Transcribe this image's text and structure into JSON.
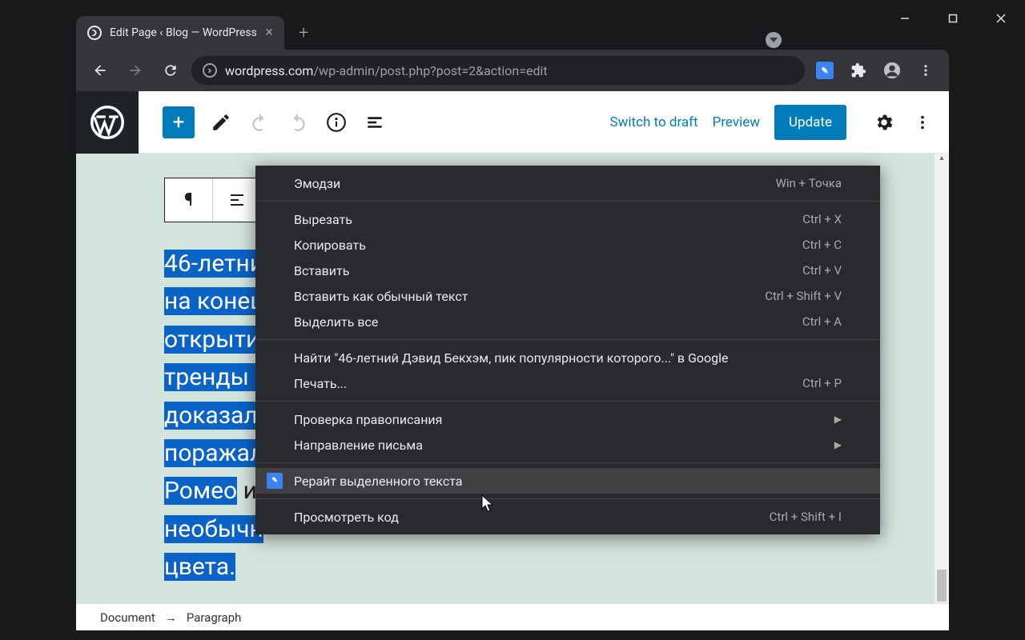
{
  "window": {
    "minimize": "—",
    "maximize": "☐",
    "close": "✕"
  },
  "tab": {
    "title": "Edit Page ‹ Blog — WordPress"
  },
  "url": {
    "host": "wordpress.com",
    "path": "/wp-admin/post.php?post=2&action=edit"
  },
  "wp": {
    "switch_draft": "Switch to draft",
    "preview": "Preview",
    "update": "Update"
  },
  "selected_lines": [
    "46-летни",
    "на конеш",
    "открытие",
    "тренды в",
    "доказал,",
    "поражал",
    "Ромео",
    "необычн",
    "цвета."
  ],
  "romeo_tail": " и",
  "breadcrumb": {
    "a": "Document",
    "sep": "→",
    "b": "Paragraph"
  },
  "ctx": {
    "emoji": {
      "label": "Эмодзи",
      "shortcut": "Win + Точка"
    },
    "cut": {
      "label": "Вырезать",
      "shortcut": "Ctrl + X"
    },
    "copy": {
      "label": "Копировать",
      "shortcut": "Ctrl + C"
    },
    "paste": {
      "label": "Вставить",
      "shortcut": "Ctrl + V"
    },
    "paste_plain": {
      "label": "Вставить как обычный текст",
      "shortcut": "Ctrl + Shift + V"
    },
    "select_all": {
      "label": "Выделить все",
      "shortcut": "Ctrl + A"
    },
    "search": {
      "label": "Найти \"46-летний Дэвид Бекхэм, пик популярности которого...\" в Google"
    },
    "print": {
      "label": "Печать...",
      "shortcut": "Ctrl + P"
    },
    "spellcheck": {
      "label": "Проверка правописания"
    },
    "direction": {
      "label": "Направление письма"
    },
    "rewrite": {
      "label": "Рерайт выделенного текста"
    },
    "inspect": {
      "label": "Просмотреть код",
      "shortcut": "Ctrl + Shift + I"
    }
  }
}
